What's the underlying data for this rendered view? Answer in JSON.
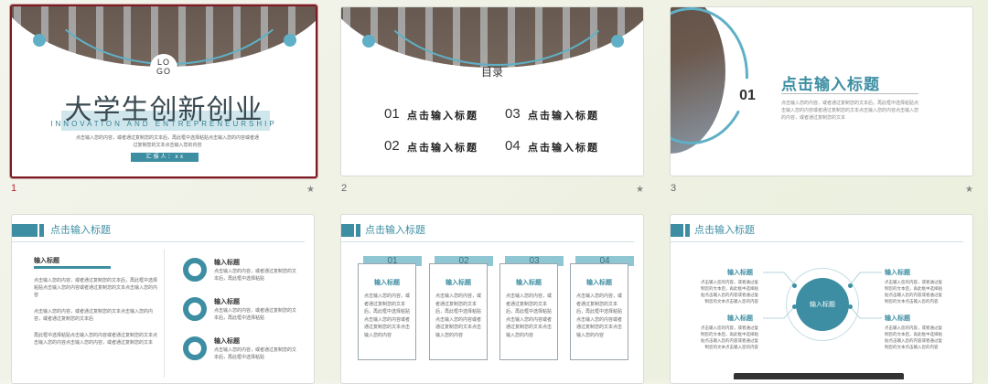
{
  "slides": [
    {
      "number": "1",
      "logo": "LO\nGO",
      "title": "大学生创新创业",
      "subtitle": "INNOVATION AND ENTREPRENEURSHIP",
      "body": "点击输入您的内容，或者通过复制您的文本后，再此框中选择粘贴点击输入您的内容或者通过复制您的文本点击输入您的内容",
      "button": "汇 报 人 ： x x"
    },
    {
      "number": "2",
      "title": "目录",
      "items": [
        {
          "num": "01",
          "label": "点击输入标题"
        },
        {
          "num": "03",
          "label": "点击输入标题"
        },
        {
          "num": "02",
          "label": "点击输入标题"
        },
        {
          "num": "04",
          "label": "点击输入标题"
        }
      ]
    },
    {
      "number": "3",
      "circle_num": "01",
      "title": "点击输入标题",
      "body": "点击输入您的内容，或者通过复制您的文本后，再此框中选择粘贴点击输入您的内容或者通过复制您的文本点击输入您的内容点击输入您的内容，或者通过复制您的文本"
    },
    {
      "header": "点击输入标题",
      "left_title": "输入标题",
      "left_paras": [
        "点击输入您的内容，或者通过复制您的文本后，再此框中选择粘贴点击输入您的内容或者通过复制您的文本点击输入您的内容",
        "点击输入您的内容，或者通过复制您的文本点击输入您的内容，或者通过复制您的文本后",
        "再此框中选择粘贴点击输入您的内容或者通过复制您的文本点击输入您的内容点击输入您的内容，或者通过复制您的文本"
      ],
      "right_items": [
        {
          "title": "输入标题",
          "text": "点击输入您的内容，或者通过复制您的文本后，再此框中选择粘贴"
        },
        {
          "title": "输入标题",
          "text": "点击输入您的内容，或者通过复制您的文本后，再此框中选择粘贴"
        },
        {
          "title": "输入标题",
          "text": "点击输入您的内容，或者通过复制您的文本后，再此框中选择粘贴"
        }
      ]
    },
    {
      "header": "点击输入标题",
      "cards": [
        {
          "num": "01",
          "title": "输入标题",
          "text": "点击输入您的内容，或者通过复制您的文本后，再此框中选择粘贴点击输入您的内容或者通过复制您的文本点击输入您的内容"
        },
        {
          "num": "02",
          "title": "输入标题",
          "text": "点击输入您的内容，或者通过复制您的文本后，再此框中选择粘贴点击输入您的内容或者通过复制您的文本点击输入您的内容"
        },
        {
          "num": "03",
          "title": "输入标题",
          "text": "点击输入您的内容，或者通过复制您的文本后，再此框中选择粘贴点击输入您的内容或者通过复制您的文本点击输入您的内容"
        },
        {
          "num": "04",
          "title": "输入标题",
          "text": "点击输入您的内容，或者通过复制您的文本后，再此框中选择粘贴点击输入您的内容或者通过复制您的文本点击输入您的内容"
        }
      ]
    },
    {
      "header": "点击输入标题",
      "center": "输入标题",
      "items": [
        {
          "title": "输入标题",
          "text": "点击输入您的内容，或者通过复制您的文本后，再此框中选择粘贴点击输入您的内容或者通过复制您的文本点击输入您的内容"
        },
        {
          "title": "输入标题",
          "text": "点击输入您的内容，或者通过复制您的文本后，再此框中选择粘贴点击输入您的内容或者通过复制您的文本点击输入您的内容"
        },
        {
          "title": "输入标题",
          "text": "点击输入您的内容，或者通过复制您的文本后，再此框中选择粘贴点击输入您的内容或者通过复制您的文本点击输入您的内容"
        },
        {
          "title": "输入标题",
          "text": "点击输入您的内容，或者通过复制您的文本后，再此框中选择粘贴点击输入您的内容或者通过复制您的文本点击输入您的内容"
        }
      ]
    }
  ],
  "star_icon": "★",
  "colors": {
    "accent": "#3d8ea3",
    "light_accent": "#5fb0c6",
    "selection": "#7d1a22"
  }
}
